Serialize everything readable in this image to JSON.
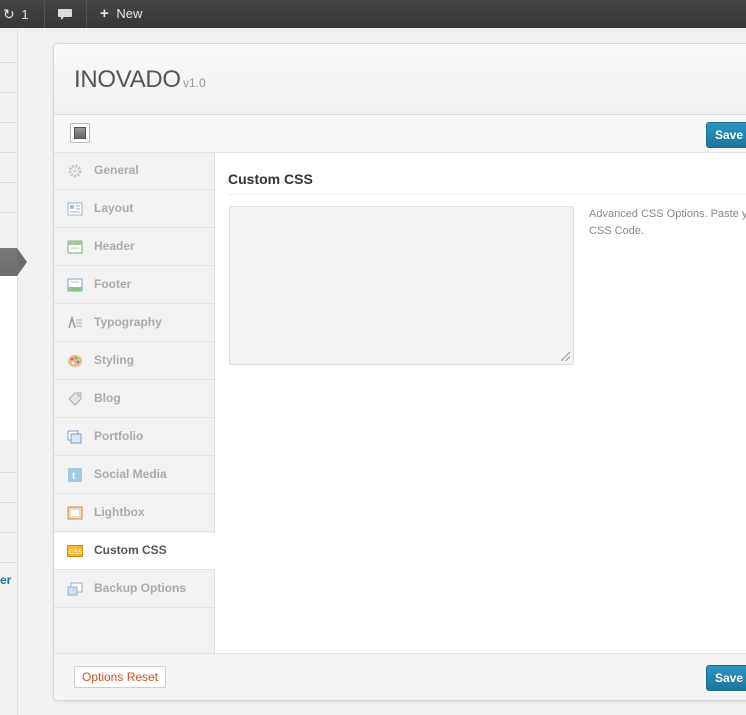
{
  "admin_bar": {
    "updates_count": "1",
    "new_label": "New"
  },
  "wp_menu": {
    "partial_link": "er"
  },
  "header": {
    "brand": "INOVADO",
    "version": "v1.0"
  },
  "toolbar": {
    "save_label": "Save All Changes"
  },
  "sidebar": {
    "items": [
      {
        "label": "General",
        "icon": "gear-icon"
      },
      {
        "label": "Layout",
        "icon": "layout-icon"
      },
      {
        "label": "Header",
        "icon": "header-icon"
      },
      {
        "label": "Footer",
        "icon": "footer-icon"
      },
      {
        "label": "Typography",
        "icon": "typography-icon"
      },
      {
        "label": "Styling",
        "icon": "palette-icon"
      },
      {
        "label": "Blog",
        "icon": "tag-icon"
      },
      {
        "label": "Portfolio",
        "icon": "portfolio-icon"
      },
      {
        "label": "Social Media",
        "icon": "twitter-icon"
      },
      {
        "label": "Lightbox",
        "icon": "lightbox-icon"
      },
      {
        "label": "Custom CSS",
        "icon": "css-icon",
        "active": true
      },
      {
        "label": "Backup Options",
        "icon": "backup-icon"
      }
    ]
  },
  "content": {
    "section_title": "Custom CSS",
    "textarea_value": "",
    "description": "Advanced CSS Options. Paste your CSS Code."
  },
  "footer": {
    "reset_label": "Options Reset",
    "save_label": "Save All Changes"
  },
  "colors": {
    "accent": "#21759b",
    "reset_text": "#d54e21",
    "active_icon": "#e8a317"
  }
}
